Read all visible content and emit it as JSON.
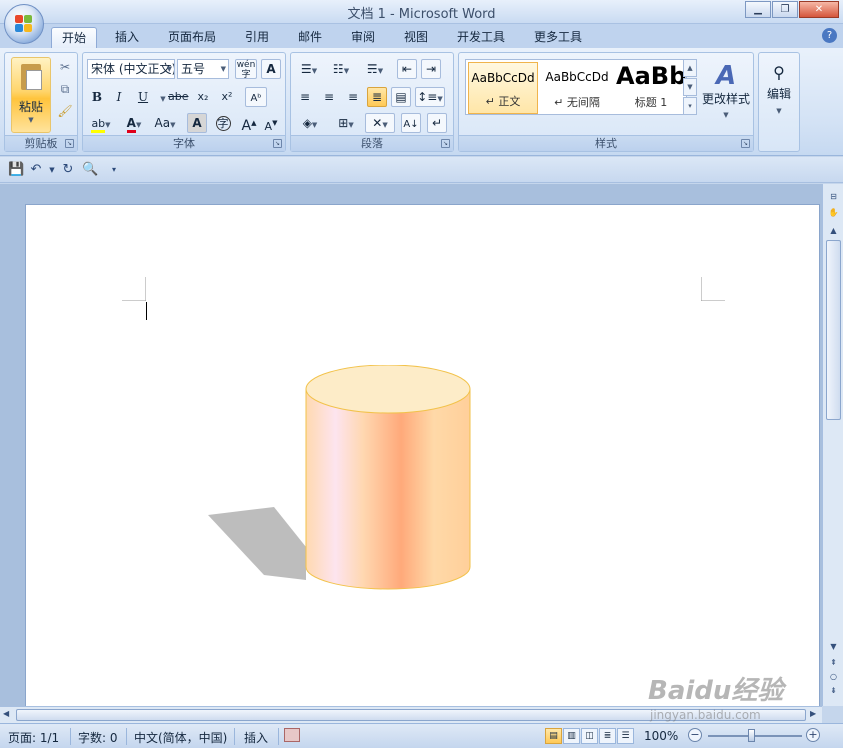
{
  "window": {
    "title": "文档 1 - Microsoft Word",
    "minimize_icon": "minimize-icon",
    "maximize_icon": "restore-icon",
    "close_icon": "close-icon"
  },
  "tabs": [
    {
      "label": "开始",
      "active": true
    },
    {
      "label": "插入"
    },
    {
      "label": "页面布局"
    },
    {
      "label": "引用"
    },
    {
      "label": "邮件"
    },
    {
      "label": "审阅"
    },
    {
      "label": "视图"
    },
    {
      "label": "开发工具"
    },
    {
      "label": "更多工具"
    }
  ],
  "ribbon": {
    "clipboard": {
      "label": "剪贴板",
      "paste_label": "粘贴"
    },
    "font": {
      "label": "字体",
      "font_name": "宋体 (中文正文)",
      "font_size": "五号",
      "buttons": {
        "bold": "B",
        "italic": "I",
        "underline": "U",
        "strike": "abe",
        "subscript": "x₂",
        "superscript": "x²",
        "font_color": "A",
        "change_case": "Aa",
        "char_shading": "A",
        "enclose": "字",
        "grow": "A",
        "shrink": "A",
        "phonetic": "wén",
        "border": "A"
      }
    },
    "paragraph": {
      "label": "段落"
    },
    "styles": {
      "label": "样式",
      "items": [
        {
          "sample": "AaBbCcDd",
          "name": "↵ 正文"
        },
        {
          "sample": "AaBbCcDd",
          "name": "↵ 无间隔"
        },
        {
          "sample": "AaBb",
          "name": "标题 1"
        }
      ],
      "change_styles": "更改样式"
    },
    "editing": {
      "label": "编辑"
    }
  },
  "statusbar": {
    "page": "页面: 1/1",
    "words": "字数: 0",
    "language": "中文(简体，中国)",
    "mode": "插入",
    "zoom": "100%",
    "zoom_percent": 100
  },
  "watermark": {
    "main": "Baidu经验",
    "sub": "jingyan.baidu.com"
  },
  "colors": {
    "cylinder_top": "#fdecc8",
    "cylinder_outline": "#f2c24a",
    "shadow": "#bdbdbd",
    "accent": "#ffc956"
  }
}
